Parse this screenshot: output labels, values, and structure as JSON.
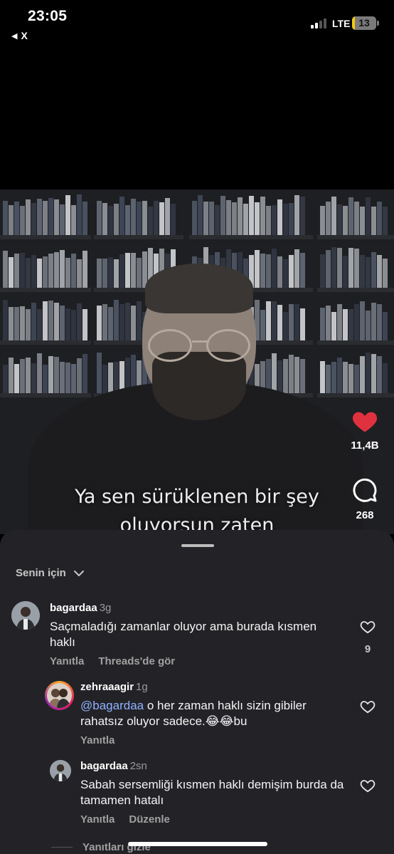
{
  "status_bar": {
    "time": "23:05",
    "back_label": "X",
    "network": "LTE",
    "battery": "13",
    "battery_level": 0.13,
    "signal_bars_active": 2
  },
  "video": {
    "subtitle_line1": "Ya sen sürüklenen bir şey",
    "subtitle_line2": "oluyorsun zaten",
    "like_count": "11,4B",
    "comment_count": "268",
    "like_color": "#e0313f"
  },
  "comments": {
    "sort_label": "Senin için",
    "items": [
      {
        "username": "bagardaa",
        "ago": "3g",
        "text": "Saçmaladığı zamanlar oluyor ama burada kısmen haklı",
        "reply_label": "Yanıtla",
        "extra_action": "Threads'de gör",
        "likes": "9"
      },
      {
        "username": "zehraaagir",
        "ago": "1g",
        "mention": "@bagardaa",
        "text": " o her zaman haklı sizin gibiler rahatsız oluyor sadece.",
        "emoji": "😂😂",
        "text_tail": "bu",
        "reply_label": "Yanıtla"
      },
      {
        "username": "bagardaa",
        "ago": "2sn",
        "text": "Sabah sersemliği kısmen haklı demişim burda da tamamen hatalı",
        "reply_label": "Yanıtla",
        "extra_action": "Düzenle"
      }
    ],
    "hide_replies_label": "Yanıtları gizle"
  }
}
